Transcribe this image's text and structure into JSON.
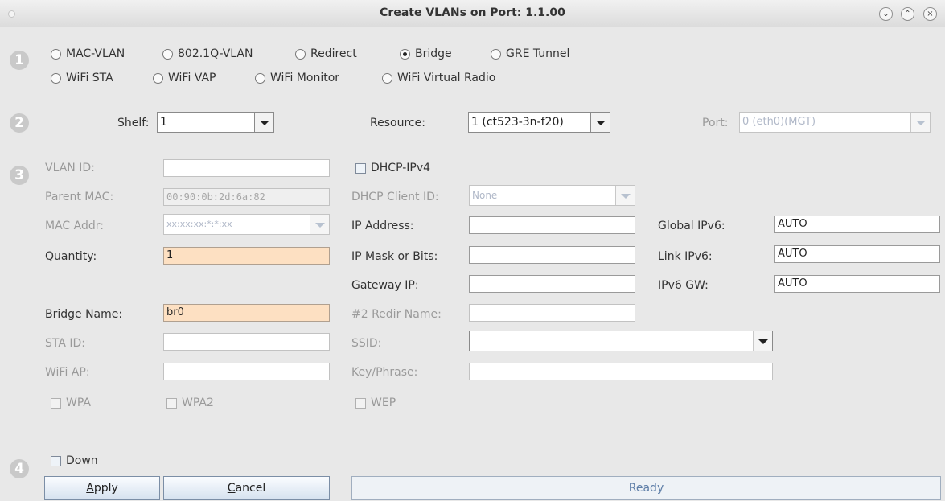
{
  "window": {
    "title": "Create VLANs on Port: 1.1.00"
  },
  "steps": [
    "1",
    "2",
    "3",
    "4"
  ],
  "port_types": [
    {
      "label": "MAC-VLAN",
      "selected": false
    },
    {
      "label": "802.1Q-VLAN",
      "selected": false
    },
    {
      "label": "Redirect",
      "selected": false
    },
    {
      "label": "Bridge",
      "selected": true
    },
    {
      "label": "GRE Tunnel",
      "selected": false
    },
    {
      "label": "WiFi STA",
      "selected": false
    },
    {
      "label": "WiFi VAP",
      "selected": false
    },
    {
      "label": "WiFi Monitor",
      "selected": false
    },
    {
      "label": "WiFi Virtual Radio",
      "selected": false
    }
  ],
  "location": {
    "shelf_label": "Shelf:",
    "shelf_value": "1",
    "resource_label": "Resource:",
    "resource_value": "1 (ct523-3n-f20)",
    "port_label": "Port:",
    "port_value": "0 (eth0)(MGT)"
  },
  "config": {
    "vlan_id_label": "VLAN ID:",
    "vlan_id_value": "",
    "parent_mac_label": "Parent MAC:",
    "parent_mac_value": "00:90:0b:2d:6a:82",
    "mac_addr_label": "MAC Addr:",
    "mac_addr_value": "xx:xx:xx:*:*:xx",
    "quantity_label": "Quantity:",
    "quantity_value": "1",
    "bridge_name_label": "Bridge Name:",
    "bridge_name_value": "br0",
    "sta_id_label": "STA ID:",
    "sta_id_value": "",
    "wifi_ap_label": "WiFi AP:",
    "wifi_ap_value": "",
    "wpa_label": "WPA",
    "wpa2_label": "WPA2",
    "dhcp_label": "DHCP-IPv4",
    "dhcp_client_id_label": "DHCP Client ID:",
    "dhcp_client_id_value": "None",
    "ip_address_label": "IP Address:",
    "ip_address_value": "",
    "ip_mask_label": "IP Mask or Bits:",
    "ip_mask_value": "",
    "gateway_label": "Gateway IP:",
    "gateway_value": "",
    "redir_label": "#2 Redir Name:",
    "redir_value": "",
    "ssid_label": "SSID:",
    "ssid_value": "",
    "key_label": "Key/Phrase:",
    "key_value": "",
    "wep_label": "WEP",
    "global_ipv6_label": "Global IPv6:",
    "global_ipv6_value": "AUTO",
    "link_ipv6_label": "Link IPv6:",
    "link_ipv6_value": "AUTO",
    "ipv6_gw_label": "IPv6 GW:",
    "ipv6_gw_value": "AUTO"
  },
  "footer": {
    "down_label": "Down",
    "apply_underlined": "A",
    "apply_rest": "pply",
    "cancel_underlined": "C",
    "cancel_rest": "ancel",
    "status": "Ready"
  }
}
